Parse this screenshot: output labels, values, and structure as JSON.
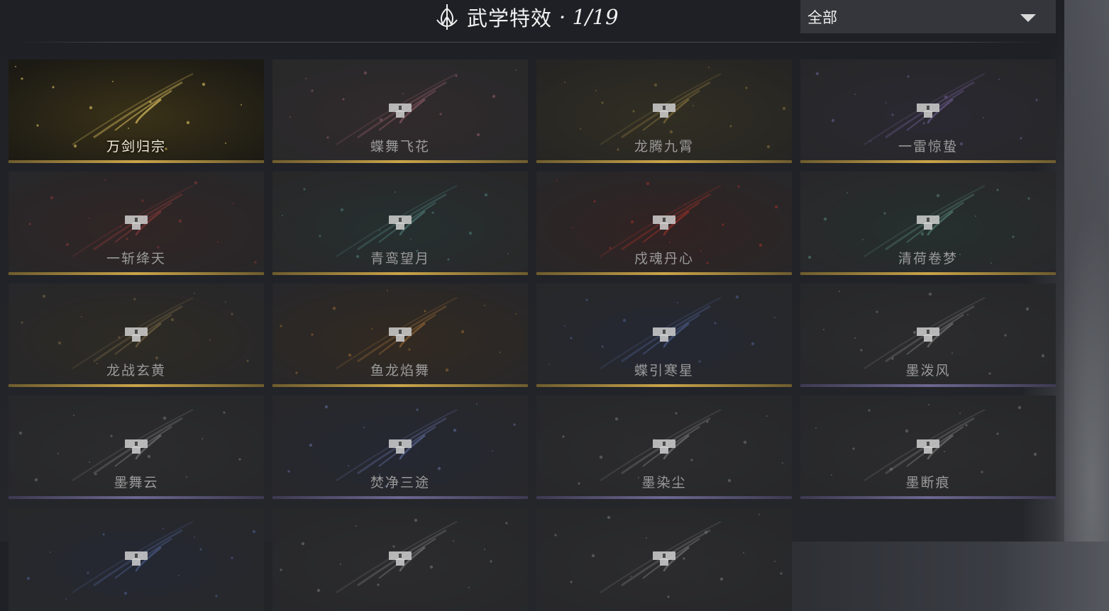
{
  "header": {
    "title": "武学特效",
    "count": "· 1/19",
    "emblem_icon": "lotus-sword-emblem-icon"
  },
  "filter": {
    "selected": "全部",
    "icon": "dropdown-triangle-icon"
  },
  "colors": {
    "gold_accent": "#c9a44a",
    "purple_accent": "#6d6790",
    "locked_text": "#9a9a9a"
  },
  "effects": [
    {
      "name": "万剑归宗",
      "unlocked": true,
      "tier": "gold",
      "theme": "gold"
    },
    {
      "name": "蝶舞飞花",
      "unlocked": false,
      "tier": "gold",
      "theme": "pink"
    },
    {
      "name": "龙腾九霄",
      "unlocked": false,
      "tier": "gold",
      "theme": "golddragon"
    },
    {
      "name": "一雷惊蛰",
      "unlocked": false,
      "tier": "gold",
      "theme": "violet"
    },
    {
      "name": "一斩绛天",
      "unlocked": false,
      "tier": "gold",
      "theme": "red"
    },
    {
      "name": "青鸾望月",
      "unlocked": false,
      "tier": "gold",
      "theme": "teal"
    },
    {
      "name": "戍魂丹心",
      "unlocked": false,
      "tier": "gold",
      "theme": "crimson"
    },
    {
      "name": "清荷卷梦",
      "unlocked": false,
      "tier": "gold",
      "theme": "lotus"
    },
    {
      "name": "龙战玄黄",
      "unlocked": false,
      "tier": "gold",
      "theme": "bronze"
    },
    {
      "name": "鱼龙焰舞",
      "unlocked": false,
      "tier": "gold",
      "theme": "orange"
    },
    {
      "name": "蝶引寒星",
      "unlocked": false,
      "tier": "gold",
      "theme": "blue"
    },
    {
      "name": "墨泼风",
      "unlocked": false,
      "tier": "purple",
      "theme": "ink"
    },
    {
      "name": "墨舞云",
      "unlocked": false,
      "tier": "purple",
      "theme": "ink"
    },
    {
      "name": "焚净三途",
      "unlocked": false,
      "tier": "purple",
      "theme": "bluewhite"
    },
    {
      "name": "墨染尘",
      "unlocked": false,
      "tier": "purple",
      "theme": "ink"
    },
    {
      "name": "墨断痕",
      "unlocked": false,
      "tier": "purple",
      "theme": "ink"
    },
    {
      "name": "",
      "unlocked": false,
      "tier": "none",
      "theme": "blue"
    },
    {
      "name": "",
      "unlocked": false,
      "tier": "none",
      "theme": "ink"
    },
    {
      "name": "",
      "unlocked": false,
      "tier": "none",
      "theme": "ink"
    }
  ]
}
